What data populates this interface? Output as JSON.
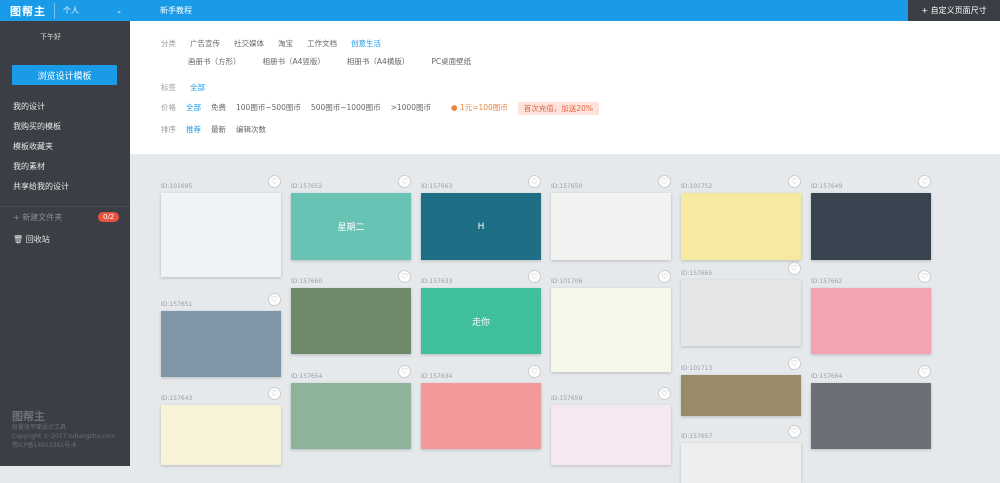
{
  "sidebar": {
    "logo": "图帮主",
    "account": "个人",
    "greeting": "下午好",
    "browse": "浏览设计模板",
    "nav": [
      "我的设计",
      "我购买的模板",
      "模板收藏夹",
      "我的素材",
      "共享给我的设计"
    ],
    "new_folder": "+ 新建文件夹",
    "folder_count": "0/2",
    "trash": "回收站",
    "footer": {
      "logo": "图帮主",
      "tagline": "轻量级平面设计工具",
      "copyright": "Copyright © 2017 tubangzhu.com",
      "icp": "鄂ICP备14013361号-8"
    }
  },
  "topbar": {
    "tutorial": "新手教程",
    "custom_size": "+ 自定义页面尺寸"
  },
  "filters": {
    "category": {
      "label": "分类",
      "items": [
        "广告宣传",
        "社交媒体",
        "淘宝",
        "工作文档",
        "创意生活"
      ],
      "active": "创意生活"
    },
    "subcategory": [
      "画册书（方形）",
      "相册书（A4竖版）",
      "相册书（A4横版）",
      "PC桌面壁纸"
    ],
    "tag": {
      "label": "标签",
      "items": [
        "全部"
      ]
    },
    "price": {
      "label": "价格",
      "items": [
        "全部",
        "免费",
        "100图币~500图币",
        "500图币~1000图币",
        ">1000图币"
      ],
      "rate": "1元=100图币",
      "promo": "首次充值，加送20%"
    },
    "sort": {
      "label": "排序",
      "items": [
        "推荐",
        "最新",
        "编辑次数"
      ]
    }
  },
  "cards": [
    {
      "id": "ID:101695",
      "color": "#eef3f6",
      "text": ""
    },
    {
      "id": "ID:157651",
      "color": "#7f96a6",
      "text": ""
    },
    {
      "id": "ID:157643",
      "color": "#f7f2d8",
      "text": ""
    },
    {
      "id": "ID:157652",
      "color": "#68c3b5",
      "text": "星期二"
    },
    {
      "id": "ID:157660",
      "color": "#6f8a6a",
      "text": ""
    },
    {
      "id": "ID:157654",
      "color": "#8fb39a",
      "text": ""
    },
    {
      "id": "ID:157663",
      "color": "#1e6f86",
      "text": "H"
    },
    {
      "id": "ID:157633",
      "color": "#3fbf9c",
      "text": "走你"
    },
    {
      "id": "ID:157634",
      "color": "#f29a9a",
      "text": ""
    },
    {
      "id": "ID:157650",
      "color": "#f2f2f0",
      "text": ""
    },
    {
      "id": "ID:101706",
      "color": "#f5f7e8",
      "text": ""
    },
    {
      "id": "ID:157659",
      "color": "#f6e8f2",
      "text": ""
    },
    {
      "id": "ID:101752",
      "color": "#f5eaa0",
      "text": ""
    },
    {
      "id": "ID:157665",
      "color": "#e4e6e8",
      "text": ""
    },
    {
      "id": "ID:101713",
      "color": "#9a8a6a",
      "text": ""
    },
    {
      "id": "ID:157657",
      "color": "#eeeeee",
      "text": ""
    },
    {
      "id": "ID:157649",
      "color": "#3a4350",
      "text": ""
    },
    {
      "id": "ID:157662",
      "color": "#f2a5b0",
      "text": ""
    },
    {
      "id": "ID:157664",
      "color": "#6d6f78",
      "text": ""
    }
  ]
}
